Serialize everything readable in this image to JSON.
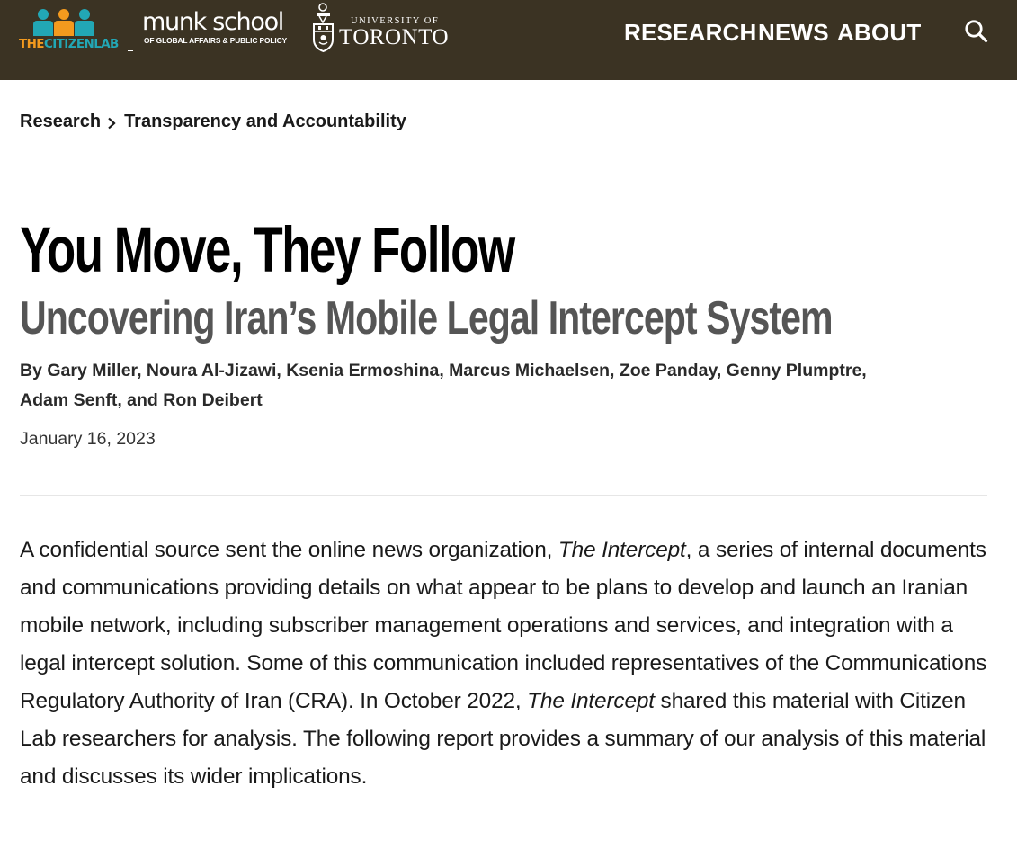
{
  "header": {
    "citizen_lab": {
      "prefix": "THE",
      "name": "CITIZENLAB"
    },
    "munk_school": {
      "title": "munk school",
      "subtitle": "OF GLOBAL AFFAIRS & PUBLIC POLICY"
    },
    "uoft": {
      "small": "UNIVERSITY OF",
      "big": "TORONTO"
    },
    "nav": {
      "research": "RESEARCH",
      "news": "NEWS",
      "about": "ABOUT"
    },
    "colors": {
      "bar": "#3b3323",
      "teal": "#22a7b5",
      "orange": "#f39a1e"
    }
  },
  "breadcrumb": {
    "items": [
      "Research",
      "Transparency and Accountability"
    ]
  },
  "article": {
    "title": "You Move, They Follow",
    "subtitle": "Uncovering Iran’s Mobile Legal Intercept System",
    "authors_line1": "By Gary Miller, Noura Al-Jizawi, Ksenia Ermoshina, Marcus Michaelsen, Zoe Panday, Genny Plumptre,",
    "authors_line2": "Adam Senft, and Ron Deibert",
    "date": "January 16, 2023",
    "body": {
      "part1": "A confidential source sent the online news organization, ",
      "italic1": "The Intercept",
      "part2": ", a series of internal documents and communications providing details on what appear to be plans to develop and launch an Iranian mobile network, including subscriber management operations and services, and integration with a legal intercept solution. Some of this communication in­cluded representatives of the Communications Regulatory Authority of Iran (CRA). In October 2022, ",
      "italic2": "The Intercept",
      "part3": " shared this material with Citizen Lab researchers for analysis. The following report provides a summary of our analysis of this material and discusses its wider implications."
    }
  }
}
